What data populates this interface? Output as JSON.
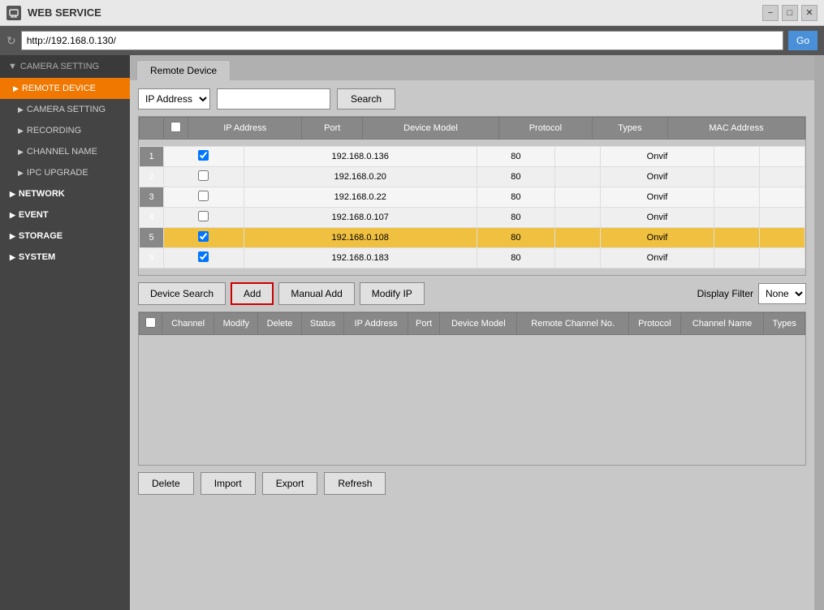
{
  "titlebar": {
    "title": "WEB SERVICE",
    "icon": "monitor-icon"
  },
  "addressbar": {
    "url": "http://192.168.0.130/",
    "go_label": "Go",
    "refresh_label": "↻"
  },
  "sidebar": {
    "header": "CAMERA SETTING",
    "items": [
      {
        "id": "remote-device",
        "label": "REMOTE DEVICE",
        "active": true,
        "arrow": "▶",
        "indent": false
      },
      {
        "id": "camera-setting",
        "label": "CAMERA SETTING",
        "active": false,
        "arrow": "▶",
        "indent": true
      },
      {
        "id": "recording",
        "label": "RECORDING",
        "active": false,
        "arrow": "▶",
        "indent": true
      },
      {
        "id": "channel-name",
        "label": "CHANNEL NAME",
        "active": false,
        "arrow": "▶",
        "indent": true
      },
      {
        "id": "ipc-upgrade",
        "label": "IPC UPGRADE",
        "active": false,
        "arrow": "▶",
        "indent": true
      },
      {
        "id": "network",
        "label": "NETWORK",
        "active": false,
        "arrow": "▶",
        "indent": false,
        "bold": true
      },
      {
        "id": "event",
        "label": "EVENT",
        "active": false,
        "arrow": "▶",
        "indent": false,
        "bold": true
      },
      {
        "id": "storage",
        "label": "STORAGE",
        "active": false,
        "arrow": "▶",
        "indent": false,
        "bold": true
      },
      {
        "id": "system",
        "label": "SYSTEM",
        "active": false,
        "arrow": "▶",
        "indent": false,
        "bold": true
      }
    ]
  },
  "tab": {
    "label": "Remote Device"
  },
  "filter": {
    "type_options": [
      "IP Address"
    ],
    "search_label": "Search",
    "placeholder": ""
  },
  "device_table": {
    "headers": [
      "",
      "IP Address",
      "Port",
      "Device Model",
      "Protocol",
      "Types",
      "MAC Address"
    ],
    "rows": [
      {
        "num": 1,
        "checked": true,
        "ip": "192.168.0.136",
        "port": "80",
        "model": "",
        "protocol": "Onvif",
        "types": "",
        "mac": "",
        "selected": false
      },
      {
        "num": 2,
        "checked": false,
        "ip": "192.168.0.20",
        "port": "80",
        "model": "",
        "protocol": "Onvif",
        "types": "",
        "mac": "",
        "selected": false
      },
      {
        "num": 3,
        "checked": false,
        "ip": "192.168.0.22",
        "port": "80",
        "model": "",
        "protocol": "Onvif",
        "types": "",
        "mac": "",
        "selected": false
      },
      {
        "num": 4,
        "checked": false,
        "ip": "192.168.0.107",
        "port": "80",
        "model": "",
        "protocol": "Onvif",
        "types": "",
        "mac": "",
        "selected": false
      },
      {
        "num": 5,
        "checked": true,
        "ip": "192.168.0.108",
        "port": "80",
        "model": "",
        "protocol": "Onvif",
        "types": "",
        "mac": "",
        "selected": true
      },
      {
        "num": 6,
        "checked": true,
        "ip": "192.168.0.183",
        "port": "80",
        "model": "",
        "protocol": "Onvif",
        "types": "",
        "mac": "",
        "selected": false
      }
    ]
  },
  "action_buttons": {
    "device_search": "Device Search",
    "add": "Add",
    "manual_add": "Manual Add",
    "modify_ip": "Modify IP",
    "display_filter_label": "Display Filter",
    "display_filter_options": [
      "None"
    ]
  },
  "channel_table": {
    "headers": [
      "",
      "Channel",
      "Modify",
      "Delete",
      "Status",
      "IP Address",
      "Port",
      "Device Model",
      "Remote Channel No.",
      "Protocol",
      "Channel Name",
      "Types"
    ]
  },
  "bottom_buttons": {
    "delete": "Delete",
    "import": "Import",
    "export": "Export",
    "refresh": "Refresh"
  }
}
